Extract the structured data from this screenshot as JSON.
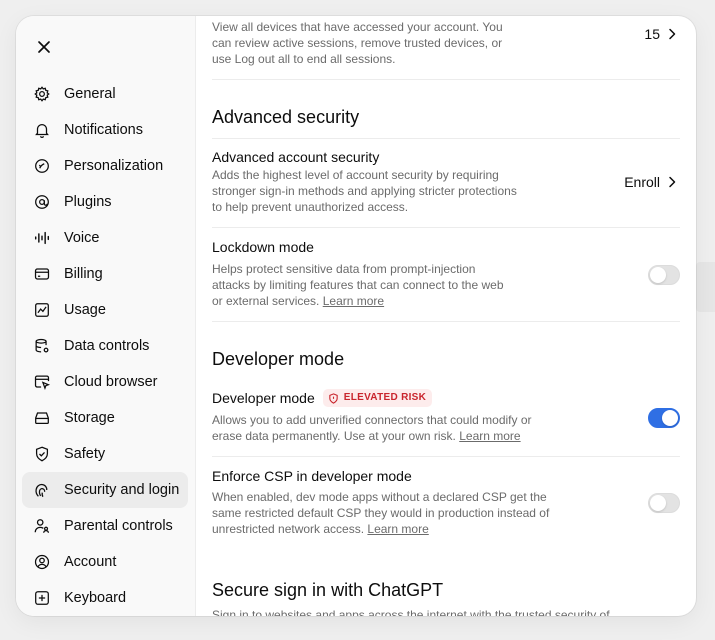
{
  "sidebar": {
    "items": [
      {
        "label": "General",
        "icon": "gear-icon"
      },
      {
        "label": "Notifications",
        "icon": "bell-icon"
      },
      {
        "label": "Personalization",
        "icon": "personalization-icon"
      },
      {
        "label": "Plugins",
        "icon": "plugins-icon"
      },
      {
        "label": "Voice",
        "icon": "voice-waveform-icon"
      },
      {
        "label": "Billing",
        "icon": "credit-card-icon"
      },
      {
        "label": "Usage",
        "icon": "chart-icon"
      },
      {
        "label": "Data controls",
        "icon": "database-icon"
      },
      {
        "label": "Cloud browser",
        "icon": "browser-cursor-icon"
      },
      {
        "label": "Storage",
        "icon": "storage-icon"
      },
      {
        "label": "Safety",
        "icon": "shield-check-icon"
      },
      {
        "label": "Security and login",
        "icon": "security-icon"
      },
      {
        "label": "Parental controls",
        "icon": "parental-icon"
      },
      {
        "label": "Account",
        "icon": "account-icon"
      },
      {
        "label": "Keyboard",
        "icon": "keyboard-icon"
      }
    ],
    "active_index": 11
  },
  "devices": {
    "description": "View all devices that have accessed your account. You can review active sessions, remove trusted devices, or use Log out all to end all sessions.",
    "count": "15"
  },
  "advanced_security": {
    "section_title": "Advanced security",
    "account_security": {
      "title": "Advanced account security",
      "description": "Adds the highest level of account security by requiring stronger sign-in methods and applying stricter protections to help prevent unauthorized access.",
      "action": "Enroll"
    },
    "lockdown": {
      "title": "Lockdown mode",
      "description": "Helps protect sensitive data from prompt-injection attacks by limiting features that can connect to the web or external services.",
      "link": "Learn more",
      "enabled": false
    }
  },
  "developer": {
    "section_title": "Developer mode",
    "mode": {
      "title": "Developer mode",
      "badge": "ELEVATED RISK",
      "description": "Allows you to add unverified connectors that could modify or erase data permanently. Use at your own risk.",
      "link": "Learn more",
      "enabled": true
    },
    "csp": {
      "title": "Enforce CSP in developer mode",
      "description": "When enabled, dev mode apps without a declared CSP get the same restricted default CSP they would in production instead of unrestricted network access.",
      "link": "Learn more",
      "enabled": false
    }
  },
  "secure_signin": {
    "section_title": "Secure sign in with ChatGPT",
    "description": "Sign in to websites and apps across the internet with the trusted security of"
  },
  "colors": {
    "toggle_on": "#2f6fe4",
    "badge_text": "#c9252d",
    "badge_bg": "#fdecec"
  }
}
